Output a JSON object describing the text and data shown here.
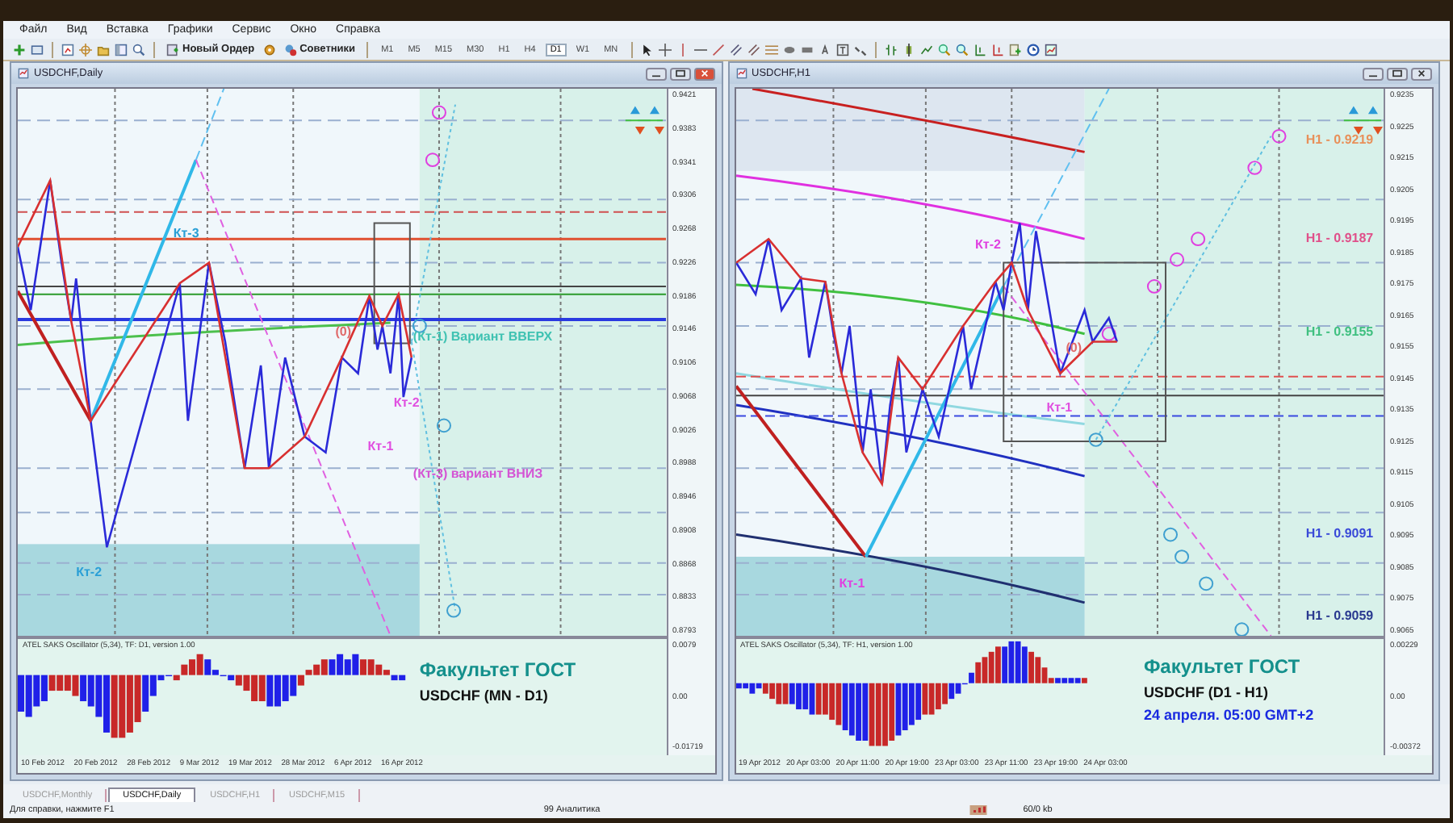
{
  "menu": [
    "Файл",
    "Вид",
    "Вставка",
    "Графики",
    "Сервис",
    "Окно",
    "Справка"
  ],
  "toolbar": {
    "new_order": "Новый Ордер",
    "experts": "Советники",
    "timeframes": [
      {
        "label": "M1",
        "selected": false
      },
      {
        "label": "M5",
        "selected": false
      },
      {
        "label": "M15",
        "selected": false
      },
      {
        "label": "M30",
        "selected": false
      },
      {
        "label": "H1",
        "selected": false
      },
      {
        "label": "H4",
        "selected": false
      },
      {
        "label": "D1",
        "selected": true
      },
      {
        "label": "W1",
        "selected": false
      },
      {
        "label": "MN",
        "selected": false
      }
    ]
  },
  "charts": [
    {
      "title": "USDCHF,Daily",
      "price_axis": [
        "0.9421",
        "0.9383",
        "0.9341",
        "0.9306",
        "0.9268",
        "0.9226",
        "0.9186",
        "0.9146",
        "0.9106",
        "0.9068",
        "0.9026",
        "0.8988",
        "0.8946",
        "0.8908",
        "0.8868",
        "0.8833",
        "0.8793"
      ],
      "labels": [
        {
          "text": "Кт-3",
          "color": "#2a9fd6"
        },
        {
          "text": "Кт-2",
          "color": "#2a9fd6"
        },
        {
          "text": "(0)",
          "color": "#e06a6a"
        },
        {
          "text": "Кт-2",
          "color": "#e050e0"
        },
        {
          "text": "Кт-1",
          "color": "#e050e0"
        },
        {
          "text": "(Кт-1)  Вариант ВВЕРХ",
          "color": "#3fc2b2"
        },
        {
          "text": "(Кт-3) вариант ВНИЗ",
          "color": "#d454d4"
        }
      ],
      "oscillator": {
        "title": "ATEL SAKS Oscillator (5,34), TF: D1, version 1.00",
        "axis": [
          "0.0079",
          "0.00",
          "-0.01719"
        ]
      },
      "overlay": [
        {
          "text": "Факультет ГОСТ",
          "kind": "brand"
        },
        {
          "text": "USDCHF (MN - D1)",
          "kind": "pair"
        }
      ],
      "dates": [
        "10 Feb 2012",
        "20 Feb 2012",
        "28 Feb 2012",
        "9 Mar 2012",
        "19 Mar 2012",
        "28 Mar 2012",
        "6 Apr 2012",
        "16 Apr 2012"
      ]
    },
    {
      "title": "USDCHF,H1",
      "price_axis": [
        "0.9235",
        "0.9225",
        "0.9215",
        "0.9205",
        "0.9195",
        "0.9185",
        "0.9175",
        "0.9165",
        "0.9155",
        "0.9145",
        "0.9135",
        "0.9125",
        "0.9115",
        "0.9105",
        "0.9095",
        "0.9085",
        "0.9075",
        "0.9065"
      ],
      "labels": [
        {
          "text": "Кт-2",
          "color": "#e040e0"
        },
        {
          "text": "Кт-1",
          "color": "#e040e0"
        },
        {
          "text": "(0)",
          "color": "#e06a6a"
        },
        {
          "text": "Кт-1",
          "color": "#e050e0"
        },
        {
          "text": "H1 - 0.9219",
          "color": "#e8905a"
        },
        {
          "text": "H1 - 0.9187",
          "color": "#e0508a"
        },
        {
          "text": "H1 - 0.9155",
          "color": "#40c080"
        },
        {
          "text": "H1 - 0.9091",
          "color": "#3a4ad8"
        },
        {
          "text": "H1 - 0.9059",
          "color": "#2a3a90"
        }
      ],
      "oscillator": {
        "title": "ATEL SAKS Oscillator (5,34), TF: H1, version 1.00",
        "axis": [
          "0.00229",
          "0.00",
          "-0.00372"
        ]
      },
      "overlay": [
        {
          "text": "Факультет ГОСТ",
          "kind": "brand"
        },
        {
          "text": "USDCHF (D1 - H1)",
          "kind": "pair"
        },
        {
          "text": "24 апреля. 05:00 GMT+2",
          "kind": "date"
        }
      ],
      "dates": [
        "19 Apr 2012",
        "20 Apr 03:00",
        "20 Apr 11:00",
        "20 Apr 19:00",
        "23 Apr 03:00",
        "23 Apr 11:00",
        "23 Apr 19:00",
        "24 Apr 03:00"
      ]
    }
  ],
  "tabs": [
    {
      "label": "USDCHF,Monthly",
      "selected": false
    },
    {
      "label": "USDCHF,Daily",
      "selected": true
    },
    {
      "label": "USDCHF,H1",
      "selected": false
    },
    {
      "label": "USDCHF,M15",
      "selected": false
    }
  ],
  "status_bar": {
    "help": "Для справки, нажмите F1",
    "profile": "99 Аналитика",
    "traffic": "60/0 kb"
  }
}
